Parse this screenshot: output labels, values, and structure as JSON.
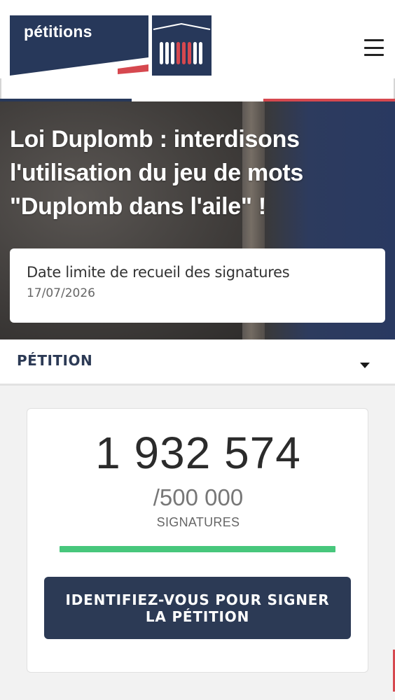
{
  "header": {
    "logo_text": "pétitions",
    "menu_icon": "hamburger-menu-icon",
    "colors": {
      "navy": "#27385a",
      "red": "#d6484f",
      "white": "#ffffff"
    }
  },
  "hero": {
    "title": "Loi Duplomb : interdisons l'utilisation du jeu de mots \"Duplomb dans l'aile\" !",
    "deadline_label": "Date limite de recueil des signatures",
    "deadline_date": "17/07/2026"
  },
  "petition_section": {
    "label": "PÉTITION",
    "toggle_icon": "caret-down-icon"
  },
  "signatures": {
    "count": "1 932 574",
    "goal": "/500 000",
    "unit": "SIGNATURES",
    "progress_percent": 100,
    "progress_color": "#47c77c"
  },
  "actions": {
    "sign_label": "IDENTIFIEZ-VOUS POUR SIGNER LA PÉTITION"
  }
}
